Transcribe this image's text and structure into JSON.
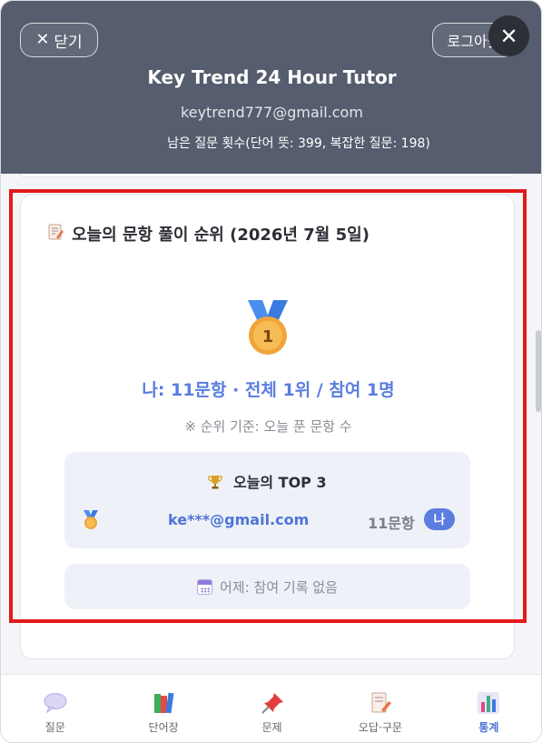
{
  "header": {
    "close_label": "닫기",
    "logout_label": "로그아웃",
    "title": "Key Trend 24 Hour Tutor",
    "email": "keytrend777@gmail.com",
    "quota": "남은 질문 횟수(단어 뜻: 399, 복잡한 질문: 198)"
  },
  "ranking_card": {
    "title": "오늘의 문항 풀이 순위 (2026년 7월 5일)",
    "medal_number": "1",
    "my_rank": "나: 11문항 · 전체 1위 / 참여 1명",
    "note": "※ 순위 기준: 오늘 푼 문항 수",
    "top3": {
      "title": "오늘의 TOP 3",
      "rows": [
        {
          "email": "ke***@gmail.com",
          "count": "11문항",
          "badge": "나"
        }
      ]
    },
    "yesterday": "어제: 참여 기록 없음"
  },
  "bottom_nav": {
    "items": [
      {
        "label": "질문",
        "icon": "speech-bubble-icon"
      },
      {
        "label": "단어장",
        "icon": "books-icon"
      },
      {
        "label": "문제",
        "icon": "pushpin-icon"
      },
      {
        "label": "오답·구문",
        "icon": "memo-icon"
      },
      {
        "label": "통계",
        "icon": "bar-chart-icon",
        "active": true
      }
    ]
  },
  "colors": {
    "header_bg": "#555d6e",
    "accent": "#5a7ddf",
    "highlight_outline": "#e21a1a"
  }
}
